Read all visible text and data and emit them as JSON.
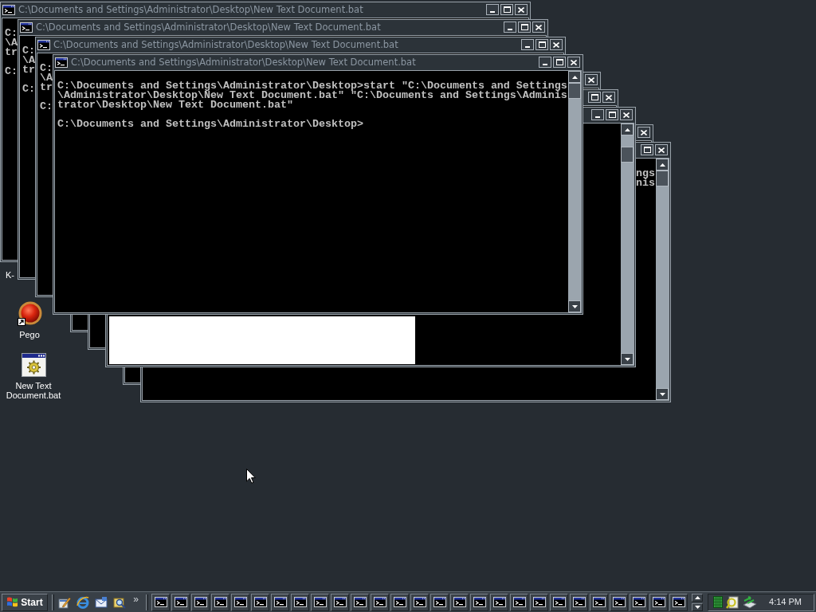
{
  "windows": [
    {
      "title": "C:\\Documents and Settings\\Administrator\\Desktop\\New Text Document.bat",
      "buttons": [
        {
          "kind": "minimize"
        },
        {
          "kind": "maximize"
        },
        {
          "kind": "close"
        }
      ],
      "output": [
        [
          "C:",
          "\\A",
          "tr"
        ],
        [
          "C:"
        ]
      ]
    },
    {
      "title": "C:\\Documents and Settings\\Administrator\\Desktop\\New Text Document.bat",
      "buttons": [
        {
          "kind": "minimize"
        },
        {
          "kind": "maximize"
        },
        {
          "kind": "close"
        }
      ],
      "output": [
        [
          "C:",
          "\\A",
          "tr"
        ],
        [
          "C:"
        ]
      ]
    },
    {
      "title": "C:\\Documents and Settings\\Administrator\\Desktop\\New Text Document.bat",
      "buttons": [
        {
          "kind": "minimize"
        },
        {
          "kind": "maximize"
        },
        {
          "kind": "close"
        }
      ],
      "output": [
        [
          "C:",
          "\\A",
          "tr"
        ],
        [
          "C:"
        ]
      ]
    },
    {
      "title": "C:\\Documents and Settings\\Administrator\\Desktop\\New Text Document.bat",
      "buttons": [
        {
          "kind": "minimize"
        },
        {
          "kind": "maximize"
        },
        {
          "kind": "close"
        }
      ],
      "output": [
        [
          "C:\\Documents and Settings\\Administrator\\Desktop>start \"C:\\Documents and Settings",
          "\\Administrator\\Desktop\\New Text Document.bat\" \"C:\\Documents and Settings\\Adminis",
          "trator\\Desktop\\New Text Document.bat\""
        ],
        [
          "C:\\Documents and Settings\\Administrator\\Desktop>"
        ]
      ]
    },
    {
      "buttons": [
        {
          "kind": "close"
        }
      ]
    },
    {
      "buttons": [
        {
          "kind": "maximize"
        },
        {
          "kind": "close"
        }
      ]
    },
    {
      "buttons": [
        {
          "kind": "minimize"
        },
        {
          "kind": "maximize"
        },
        {
          "kind": "close"
        }
      ],
      "white_patch": true
    },
    {
      "buttons": [
        {
          "kind": "close"
        }
      ]
    },
    {
      "buttons": [
        {
          "kind": "maximize"
        },
        {
          "kind": "close"
        }
      ],
      "output": [
        [
          "ngs",
          "nis"
        ]
      ]
    }
  ],
  "desktop_icons": [
    {
      "label": "K-"
    },
    {
      "kind": "sphere",
      "label": "Pego",
      "shortcut": true
    },
    {
      "kind": "batch_file",
      "label": "New Text Document.bat",
      "shortcut": false
    }
  ],
  "taskbar": {
    "start": "Start",
    "quick_launch": [
      {
        "kind": "desk"
      },
      {
        "kind": "browser"
      },
      {
        "kind": "mail"
      },
      {
        "kind": "search"
      }
    ],
    "more": "»",
    "tasks": [
      {
        "kind": "console"
      },
      {
        "kind": "console"
      },
      {
        "kind": "console"
      },
      {
        "kind": "console"
      },
      {
        "kind": "console"
      },
      {
        "kind": "console"
      },
      {
        "kind": "console"
      },
      {
        "kind": "console"
      },
      {
        "kind": "console"
      },
      {
        "kind": "console"
      },
      {
        "kind": "console"
      },
      {
        "kind": "console"
      },
      {
        "kind": "console"
      },
      {
        "kind": "console"
      },
      {
        "kind": "console"
      },
      {
        "kind": "console"
      },
      {
        "kind": "console"
      },
      {
        "kind": "console"
      },
      {
        "kind": "console"
      },
      {
        "kind": "console"
      },
      {
        "kind": "console"
      },
      {
        "kind": "console"
      },
      {
        "kind": "console"
      },
      {
        "kind": "console"
      },
      {
        "kind": "console"
      },
      {
        "kind": "console"
      },
      {
        "kind": "console"
      }
    ],
    "tray": [
      {
        "kind": "grid"
      },
      {
        "kind": "magnifier"
      },
      {
        "kind": "network"
      }
    ],
    "clock": "4:14 PM"
  }
}
